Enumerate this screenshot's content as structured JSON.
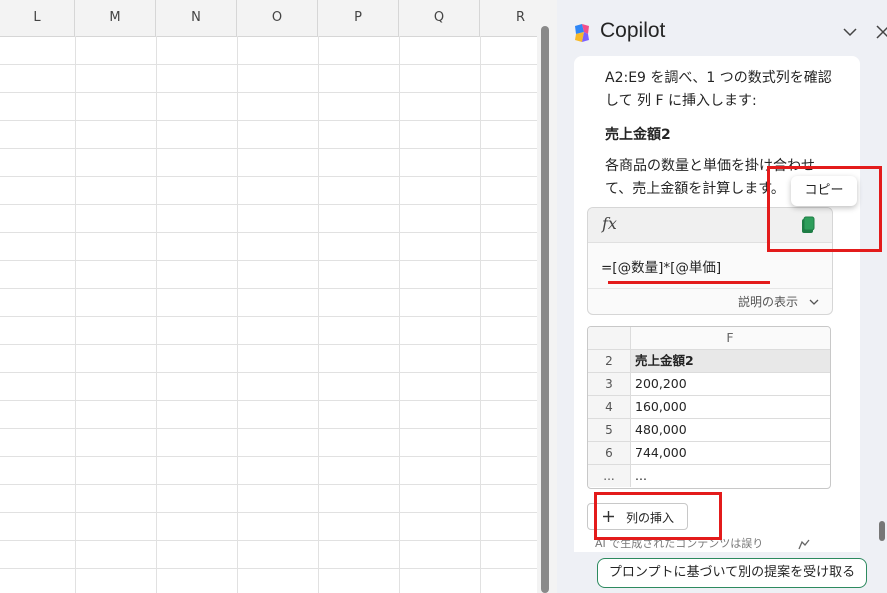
{
  "sheet": {
    "columns": [
      "L",
      "M",
      "N",
      "O",
      "P",
      "Q",
      "R"
    ]
  },
  "pane": {
    "title": "Copilot",
    "intro": [
      "A2:E9 を調べ、1 つの数式列を確認",
      "して 列 F に挿入します:"
    ],
    "section_title": "売上金額2",
    "description": [
      "各商品の数量と単価を掛け合わせ",
      "て、売上金額を計算します。"
    ],
    "tooltip": "コピー",
    "fx_label": "fx",
    "formula": "=[@数量]*[@単価]",
    "explain_label": "説明の表示",
    "preview": {
      "column_header": "F",
      "rows": [
        {
          "num": "2",
          "value": "売上金額2"
        },
        {
          "num": "3",
          "value": "200,200"
        },
        {
          "num": "4",
          "value": "160,000"
        },
        {
          "num": "5",
          "value": "480,000"
        },
        {
          "num": "6",
          "value": "744,000"
        },
        {
          "num": "...",
          "value": "..."
        }
      ]
    },
    "insert_button": "列の挿入",
    "disclaimer": "AI で生成されたコンテンツは誤り",
    "suggest_button": "プロンプトに基づいて別の提案を受け取る"
  },
  "colors": {
    "accent_green": "#2d8a5f",
    "annotation_red": "#e31b1b",
    "copy_icon_green": "#1e7d45"
  },
  "icons": [
    "copilot-logo-icon",
    "chevron-down-icon",
    "close-icon",
    "copy-icon",
    "plus-icon",
    "thumbs-up-icon"
  ]
}
